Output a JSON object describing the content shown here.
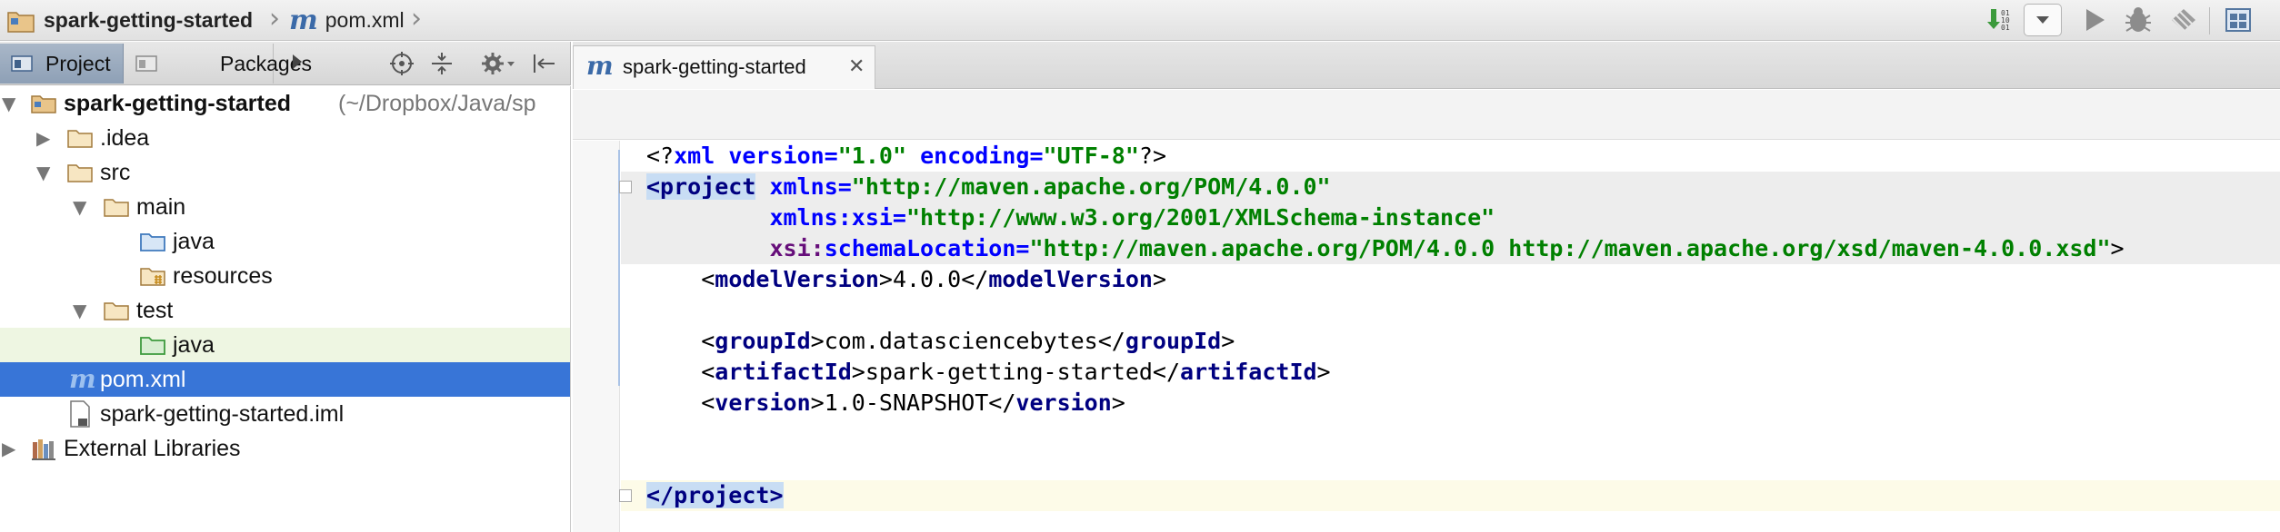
{
  "breadcrumb": {
    "project": "spark-getting-started",
    "file": "pom.xml"
  },
  "toolbar": {
    "icons": [
      "make-icon",
      "run-config-dropdown-icon",
      "run-icon",
      "debug-icon",
      "coverage-icon",
      "project-structure-icon"
    ]
  },
  "project_panel": {
    "tabs": [
      {
        "label": "Project",
        "selected": true
      },
      {
        "label": "Packages",
        "selected": false
      }
    ],
    "tree": [
      {
        "label": "spark-getting-started",
        "suffix": "(~/Dropbox/Java/sp",
        "type": "module",
        "level": 0,
        "expanded": true,
        "bold": true
      },
      {
        "label": ".idea",
        "type": "folder",
        "level": 1,
        "expanded": false
      },
      {
        "label": "src",
        "type": "folder",
        "level": 1,
        "expanded": true
      },
      {
        "label": "main",
        "type": "folder",
        "level": 2,
        "expanded": true
      },
      {
        "label": "java",
        "type": "source-folder",
        "level": 3
      },
      {
        "label": "resources",
        "type": "resource-folder",
        "level": 3
      },
      {
        "label": "test",
        "type": "folder",
        "level": 2,
        "expanded": true
      },
      {
        "label": "java",
        "type": "test-folder",
        "level": 3
      },
      {
        "label": "pom.xml",
        "type": "maven-file",
        "level": 1,
        "selected": true
      },
      {
        "label": "spark-getting-started.iml",
        "type": "iml-file",
        "level": 1
      },
      {
        "label": "External Libraries",
        "type": "libraries",
        "level": 0,
        "expanded": false
      }
    ]
  },
  "editor": {
    "tab_label": "spark-getting-started",
    "lines": {
      "l1_prefix": "<?",
      "l1_xml": "xml",
      "l1_version_attr": "version=",
      "l1_version_val": "\"1.0\"",
      "l1_enc_attr": "encoding=",
      "l1_enc_val": "\"UTF-8\"",
      "l1_suffix": "?>",
      "l2_tag": "<project",
      "l2_attr": "xmlns=",
      "l2_val": "\"http://maven.apache.org/POM/4.0.0\"",
      "l3_ns": "xmlns:",
      "l3_attr": "xsi=",
      "l3_val": "\"http://www.w3.org/2001/XMLSchema-instance\"",
      "l4_ns": "xsi:",
      "l4_attr": "schemaLocation=",
      "l4_val": "\"http://maven.apache.org/POM/4.0.0 http://maven.apache.org/xsd/maven-4.0.0.xsd\"",
      "l4_end": ">",
      "l5_open_lt": "<",
      "l5_open": "modelVersion",
      "l5_mid": ">4.0.0</",
      "l5_close": "modelVersion",
      "l5_end": ">",
      "l7_open_lt": "<",
      "l7_open": "groupId",
      "l7_mid": ">com.datasciencebytes</",
      "l7_close": "groupId",
      "l7_end": ">",
      "l8_open_lt": "<",
      "l8_open": "artifactId",
      "l8_mid": ">spark-getting-started</",
      "l8_close": "artifactId",
      "l8_end": ">",
      "l9_open_lt": "<",
      "l9_open": "version",
      "l9_mid": ">1.0-SNAPSHOT</",
      "l9_close": "version",
      "l9_end": ">",
      "l12_close": "</project>"
    }
  },
  "colors": {
    "selection": "#3875d7",
    "tag": "#000080",
    "attribute": "#0000ff",
    "namespace": "#660e7a",
    "string": "#008000",
    "caret_line": "#fdfbe8",
    "current_row_bg": "#eef6e2"
  }
}
